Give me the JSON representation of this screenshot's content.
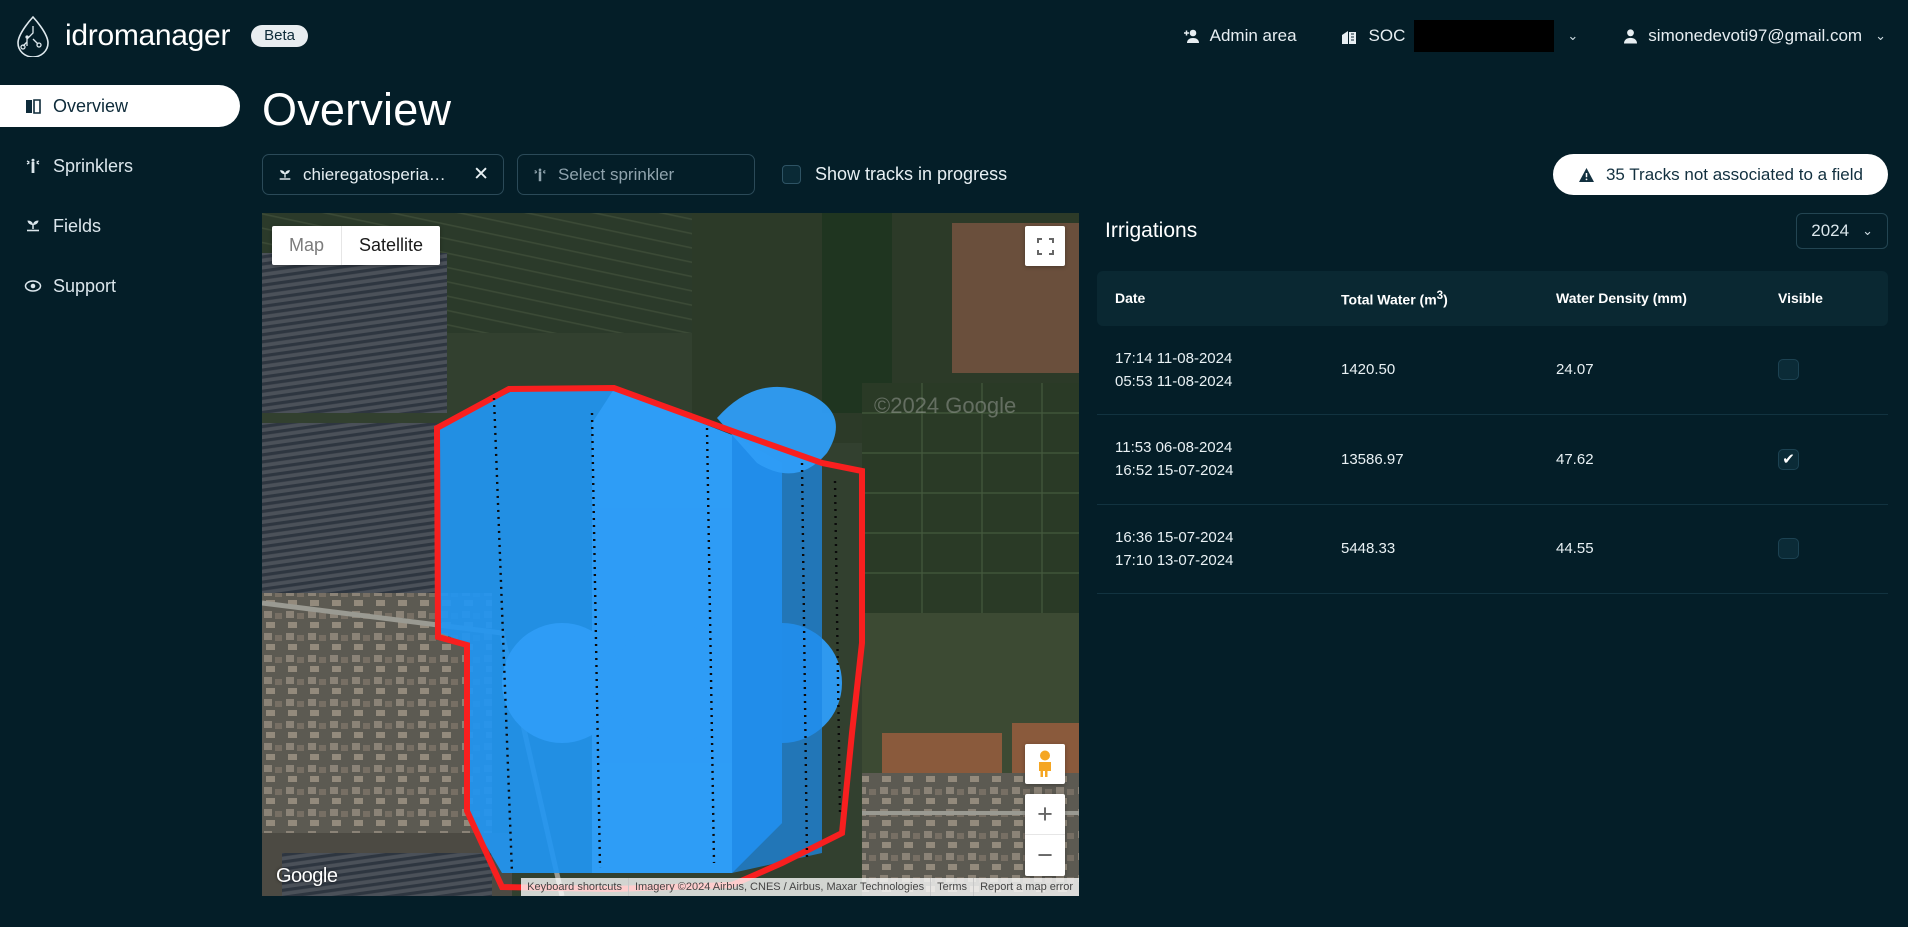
{
  "brand": {
    "name": "idromanager",
    "badge": "Beta",
    "logo_icon": "water-drop-circuit-icon"
  },
  "topnav": {
    "admin_area": "Admin area",
    "admin_icon": "add-person-icon",
    "company": "SOC",
    "company_icon": "building-icon",
    "company_redacted": true,
    "user_email": "simonedevoti97@gmail.com",
    "user_icon": "person-icon",
    "chevron": "⌄"
  },
  "sidebar": {
    "items": [
      {
        "label": "Overview",
        "icon": "map-book-icon",
        "active": true
      },
      {
        "label": "Sprinklers",
        "icon": "sprinkler-icon",
        "active": false
      },
      {
        "label": "Fields",
        "icon": "seedling-icon",
        "active": false
      },
      {
        "label": "Support",
        "icon": "support-eye-icon",
        "active": false
      }
    ]
  },
  "page": {
    "title": "Overview"
  },
  "filters": {
    "field_value": "chieregatosperia…",
    "field_icon": "seedling-icon",
    "clear_icon": "close-icon",
    "sprinkler_placeholder": "Select sprinkler",
    "sprinkler_icon": "sprinkler-icon",
    "tracks_checkbox_label": "Show tracks in progress",
    "tracks_checkbox_checked": false,
    "warning_text": "35 Tracks not associated to a field",
    "warning_icon": "warning-triangle-icon"
  },
  "map": {
    "type_map_label": "Map",
    "type_satellite_label": "Satellite",
    "active_type": "Satellite",
    "fullscreen_icon": "fullscreen-icon",
    "pegman_icon": "street-view-pegman-icon",
    "zoom_in_label": "+",
    "zoom_out_label": "−",
    "google_logo": "Google",
    "attribution": [
      "Keyboard shortcuts",
      "Imagery ©2024 Airbus, CNES / Airbus, Maxar Technologies",
      "Terms",
      "Report a map error"
    ],
    "watermark": "©2024 Google",
    "field_boundary_color": "#f81f1f",
    "irrigation_track_color": "#2196f3"
  },
  "irrigations": {
    "title": "Irrigations",
    "year": "2024",
    "year_chevron": "⌄",
    "columns": [
      "Date",
      "Total Water (m³)",
      "Water Density (mm)",
      "Visible"
    ],
    "rows": [
      {
        "date_end": "17:14 11-08-2024",
        "date_start": "05:53 11-08-2024",
        "total_water": "1420.50",
        "water_density": "24.07",
        "visible": false
      },
      {
        "date_end": "11:53 06-08-2024",
        "date_start": "16:52 15-07-2024",
        "total_water": "13586.97",
        "water_density": "47.62",
        "visible": true
      },
      {
        "date_end": "16:36 15-07-2024",
        "date_start": "17:10 13-07-2024",
        "total_water": "5448.33",
        "water_density": "44.55",
        "visible": false
      }
    ],
    "check_glyph": "✔"
  }
}
